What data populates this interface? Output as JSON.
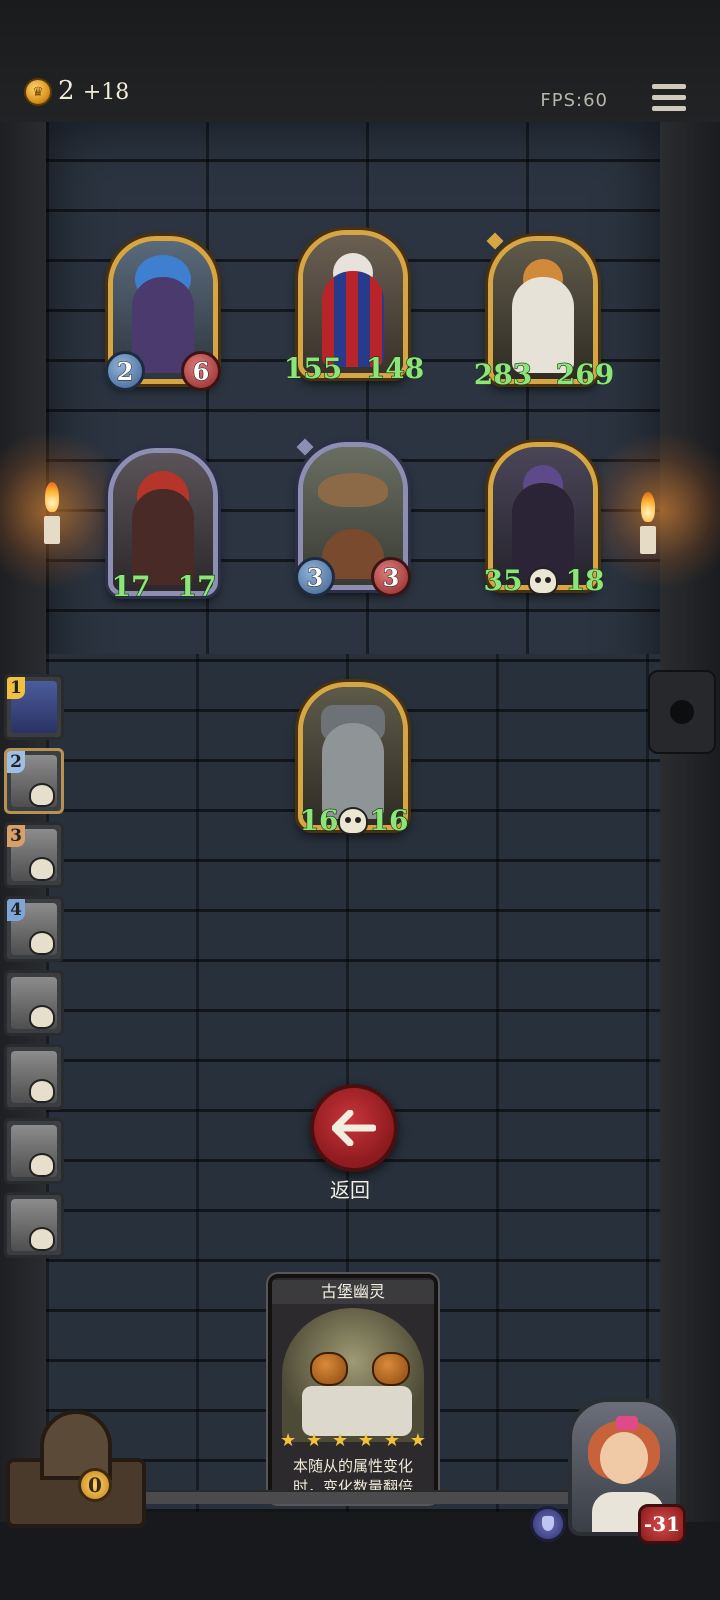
{
  "top_bar": {
    "gold": "2",
    "gold_income": "+18",
    "fps": "FPS:60"
  },
  "board": {
    "row1": [
      {
        "name": "blue-haired-elf",
        "atk": "2",
        "hp": "6"
      },
      {
        "name": "clown",
        "atk": "155",
        "hp": "148"
      },
      {
        "name": "pumpkin-ghost",
        "atk": "283",
        "hp": "269"
      }
    ],
    "row2": [
      {
        "name": "hooded-assassin",
        "atk": "17",
        "hp": "17"
      },
      {
        "name": "airship",
        "atk": "3",
        "hp": "3"
      },
      {
        "name": "dark-wizard",
        "atk": "35",
        "hp": "18"
      }
    ],
    "row3": [
      {
        "name": "robot",
        "atk": "16",
        "hp": "16"
      }
    ]
  },
  "side_list": [
    "1",
    "2",
    "3",
    "4"
  ],
  "back_button": {
    "label": "返回"
  },
  "info_card": {
    "title": "古堡幽灵",
    "stars": 6,
    "desc": "本随从的属性变化时，变化数量翻倍"
  },
  "chest": {
    "count": "0"
  },
  "hero": {
    "hp": "-31"
  }
}
